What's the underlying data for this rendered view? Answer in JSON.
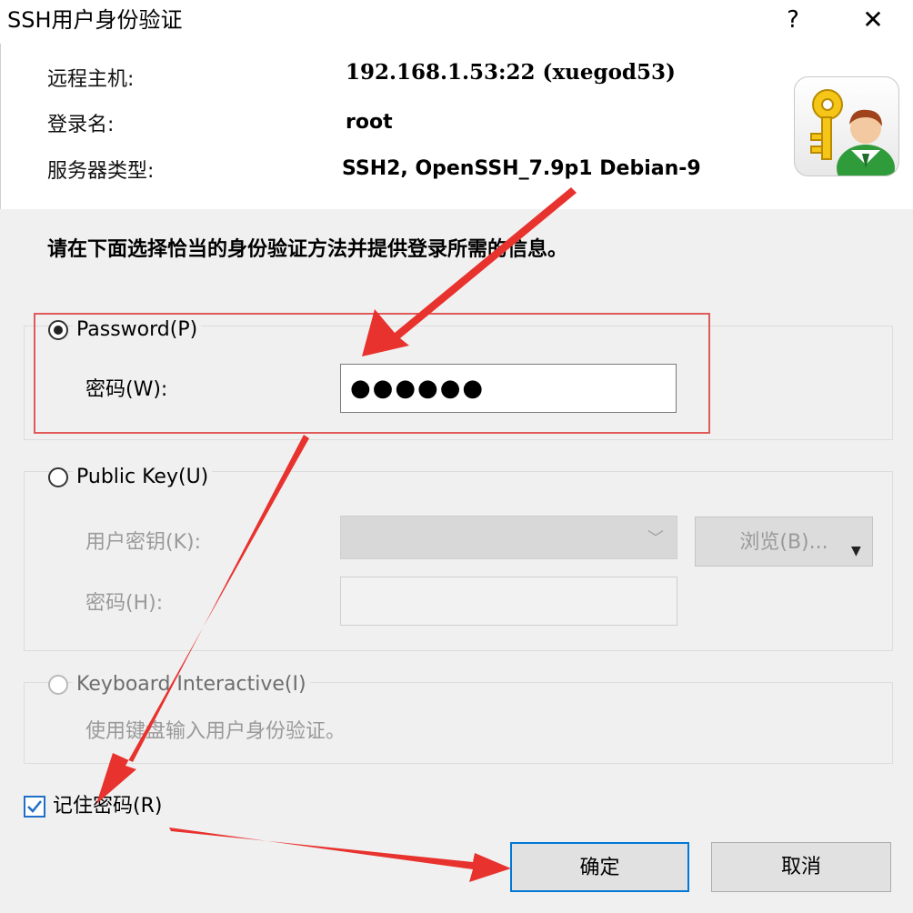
{
  "window": {
    "title": "SSH用户身份验证",
    "help_glyph": "?",
    "close_glyph": "✕"
  },
  "info": {
    "host_label": "远程主机:",
    "host_value": "192.168.1.53:22 (xuegod53)",
    "login_label": "登录名:",
    "login_value": "root",
    "server_type_label": "服务器类型:",
    "server_type_value": "SSH2, OpenSSH_7.9p1 Debian-9"
  },
  "instruction": "请在下面选择恰当的身份验证方法并提供登录所需的信息。",
  "password_option": {
    "label": "Password(P)",
    "selected": true,
    "field_label": "密码(W):",
    "field_value": "●●●●●●"
  },
  "public_key_option": {
    "label": "Public Key(U)",
    "selected": false,
    "key_label": "用户密钥(K):",
    "browse_label": "浏览(B)...",
    "passphrase_label": "密码(H):"
  },
  "keyboard_option": {
    "label": "Keyboard Interactive(I)",
    "selected": false,
    "description": "使用键盘输入用户身份验证。"
  },
  "remember": {
    "label": "记住密码(R)",
    "checked": true
  },
  "buttons": {
    "ok": "确定",
    "cancel": "取消"
  },
  "colors": {
    "annotation_red": "#e8322e",
    "focus_blue": "#0078d7",
    "dialog_bg": "#f0f0f0"
  },
  "icons": {
    "user_icon": "key-and-user-icon",
    "select_chevron": "chevron-down-icon",
    "browse_dropdown": "triangle-down-icon"
  }
}
